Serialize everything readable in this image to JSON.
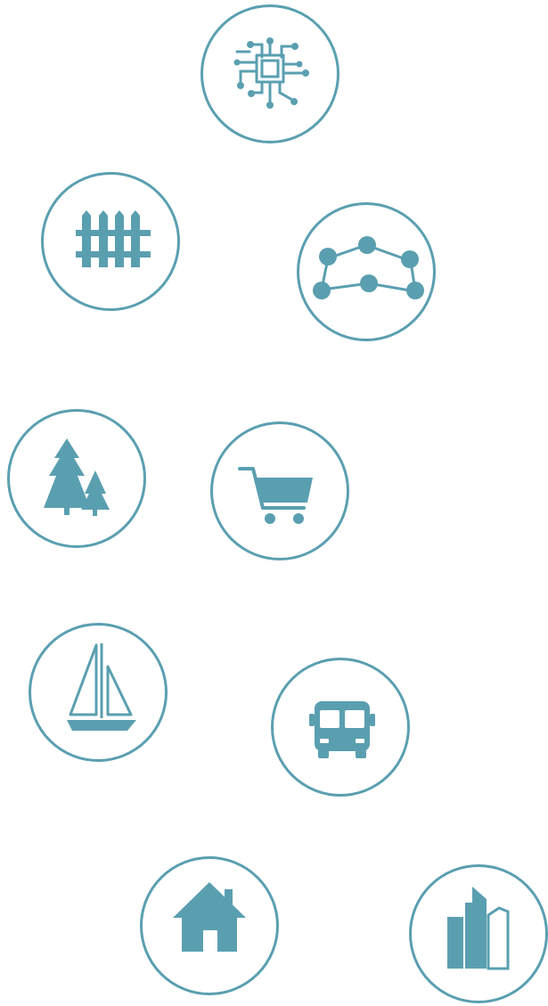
{
  "theme": {
    "accent": "#5a9fb0",
    "background": "#ffffff"
  },
  "icons": [
    {
      "name": "circuit-chip-icon"
    },
    {
      "name": "fence-icon"
    },
    {
      "name": "network-nodes-icon"
    },
    {
      "name": "pine-trees-icon"
    },
    {
      "name": "shopping-cart-icon"
    },
    {
      "name": "sailboat-icon"
    },
    {
      "name": "bus-icon"
    },
    {
      "name": "house-icon"
    },
    {
      "name": "office-building-icon"
    }
  ]
}
